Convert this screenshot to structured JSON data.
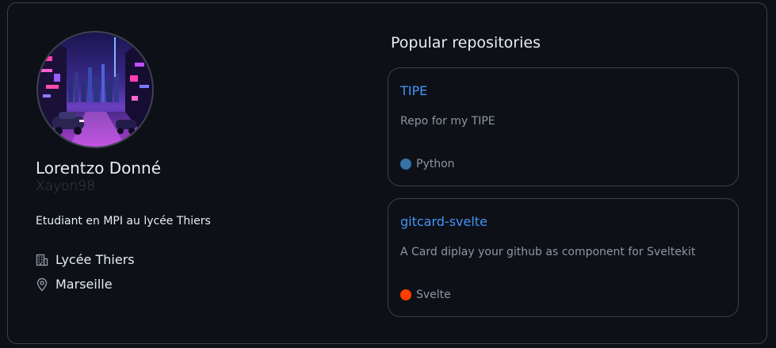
{
  "profile": {
    "name": "Lorentzo Donné",
    "username": "Xayon98",
    "bio": "Etudiant en MPI au lycée Thiers",
    "company": "Lycée Thiers",
    "location": "Marseille",
    "avatar_icon": "cyberpunk-street-avatar"
  },
  "repositories": {
    "title": "Popular repositories",
    "items": [
      {
        "name": "TIPE",
        "description": "Repo for my TIPE",
        "language": "Python",
        "language_color": "#3572a5"
      },
      {
        "name": "gitcard-svelte",
        "description": "A Card diplay your github as component for Sveltekit",
        "language": "Svelte",
        "language_color": "#ff3e00"
      }
    ]
  },
  "colors": {
    "background": "#0d1117",
    "border": "#3b4048",
    "text_primary": "#e6edf3",
    "text_muted": "#8d96a0",
    "link": "#4493f8"
  }
}
